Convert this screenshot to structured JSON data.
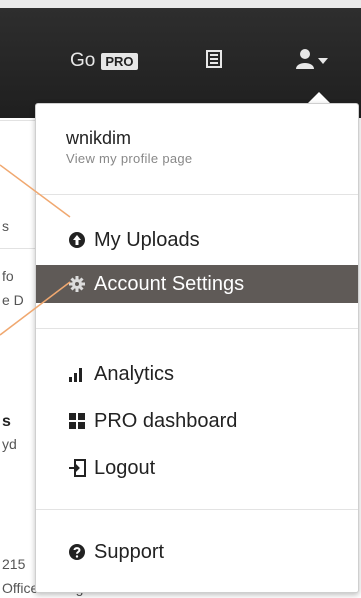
{
  "topbar": {
    "go_label": "Go",
    "pro_badge": "PRO"
  },
  "background": {
    "snippets": [
      "s",
      "fo",
      "e D",
      "s",
      "yd",
      "215",
      "Officer at DigitasLBi Paris"
    ]
  },
  "menu": {
    "username": "wnikdim",
    "profile_link": "View my profile page",
    "items": [
      {
        "label": "My Uploads",
        "icon": "upload-circle-icon"
      },
      {
        "label": "Account Settings",
        "icon": "gear-icon"
      },
      {
        "label": "Analytics",
        "icon": "bar-chart-icon"
      },
      {
        "label": "PRO dashboard",
        "icon": "dashboard-grid-icon"
      },
      {
        "label": "Logout",
        "icon": "logout-icon"
      },
      {
        "label": "Support",
        "icon": "question-circle-icon"
      }
    ]
  },
  "colors": {
    "topbar": "#2a2a2a",
    "active_item": "#5f5a57",
    "annotation_line": "#f0a870"
  }
}
